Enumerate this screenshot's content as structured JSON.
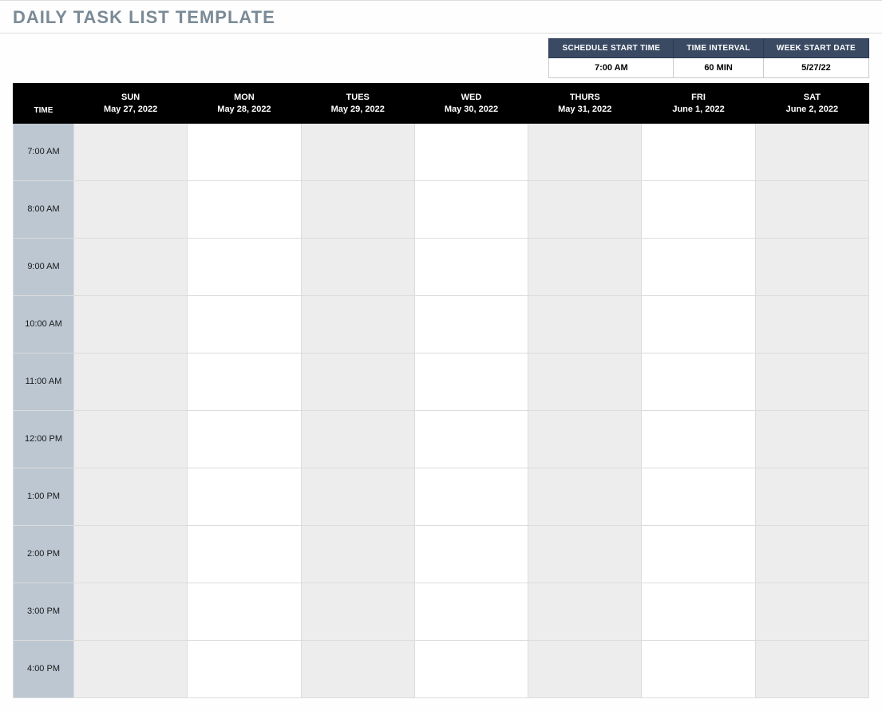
{
  "title": "DAILY TASK LIST TEMPLATE",
  "settings": {
    "headers": {
      "start_time": "SCHEDULE START TIME",
      "interval": "TIME INTERVAL",
      "week_start": "WEEK START DATE"
    },
    "values": {
      "start_time": "7:00 AM",
      "interval": "60 MIN",
      "week_start": "5/27/22"
    }
  },
  "schedule": {
    "time_header": "TIME",
    "days": [
      {
        "name": "SUN",
        "date": "May 27, 2022"
      },
      {
        "name": "MON",
        "date": "May 28, 2022"
      },
      {
        "name": "TUES",
        "date": "May 29, 2022"
      },
      {
        "name": "WED",
        "date": "May 30, 2022"
      },
      {
        "name": "THURS",
        "date": "May 31, 2022"
      },
      {
        "name": "FRI",
        "date": "June 1, 2022"
      },
      {
        "name": "SAT",
        "date": "June 2, 2022"
      }
    ],
    "times": [
      "7:00 AM",
      "8:00 AM",
      "9:00 AM",
      "10:00 AM",
      "11:00 AM",
      "12:00 PM",
      "1:00 PM",
      "2:00 PM",
      "3:00 PM",
      "4:00 PM"
    ],
    "shaded_columns": [
      0,
      2,
      4,
      6
    ]
  }
}
